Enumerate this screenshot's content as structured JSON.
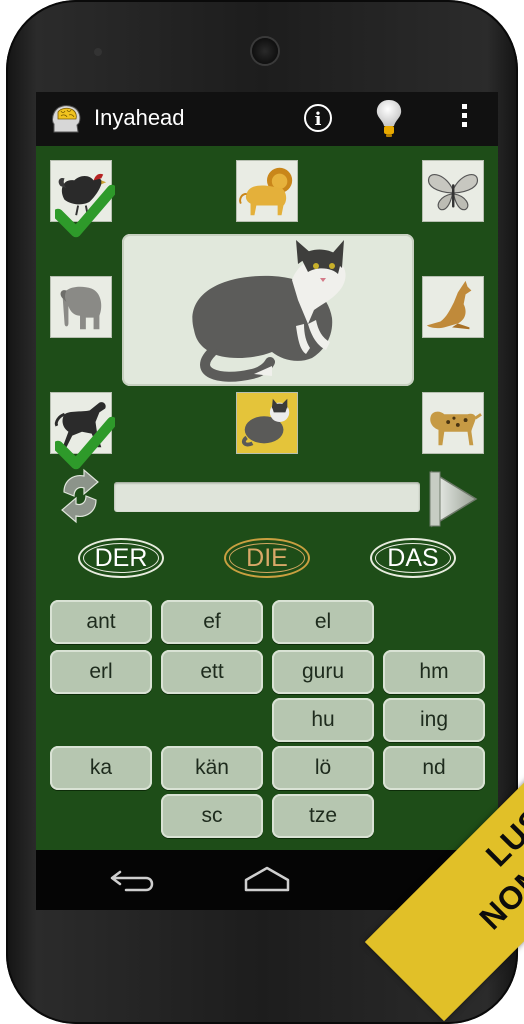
{
  "app": {
    "title": "Inyahead",
    "info_glyph": "i"
  },
  "icons": {
    "logo": "head-brain-icon",
    "info": "info-icon",
    "hint": "lightbulb-icon",
    "menu": "overflow-menu-icon",
    "refresh": "refresh-icon",
    "next": "next-arrow-icon",
    "back": "back-nav-icon",
    "home": "home-nav-icon",
    "check": "checkmark-icon"
  },
  "animals": [
    {
      "name": "hen",
      "checked": true,
      "selected": false
    },
    {
      "name": "lion",
      "checked": false,
      "selected": false
    },
    {
      "name": "butterfly",
      "checked": false,
      "selected": false
    },
    {
      "name": "elephant",
      "checked": false,
      "selected": false
    },
    {
      "name": "kangaroo",
      "checked": false,
      "selected": false
    },
    {
      "name": "horse",
      "checked": true,
      "selected": false
    },
    {
      "name": "cat",
      "checked": false,
      "selected": true
    },
    {
      "name": "dog",
      "checked": false,
      "selected": false
    }
  ],
  "current_word_image": "cat",
  "progress": 0,
  "articles": {
    "der": "DER",
    "die": "DIE",
    "das": "DAS",
    "highlighted": "die"
  },
  "syllables": {
    "row1": [
      "ant",
      "ef",
      "el"
    ],
    "row2": [
      "erl",
      "ett",
      "guru",
      "hm"
    ],
    "row3": [
      "hu",
      "ing"
    ],
    "row4": [
      "ka",
      "kän",
      "lö",
      "nd"
    ],
    "row5": [
      "sc",
      "tze"
    ]
  },
  "banner": {
    "line1": "LUSTIGE",
    "line2": "NOMENSPIELE"
  },
  "colors": {
    "board": "#1e4d18",
    "tile": "#e9ece4",
    "selected_tile": "#e4c43a",
    "check": "#2e9a2a",
    "syllable": "#b6c6b0",
    "banner": "#e1c028"
  }
}
